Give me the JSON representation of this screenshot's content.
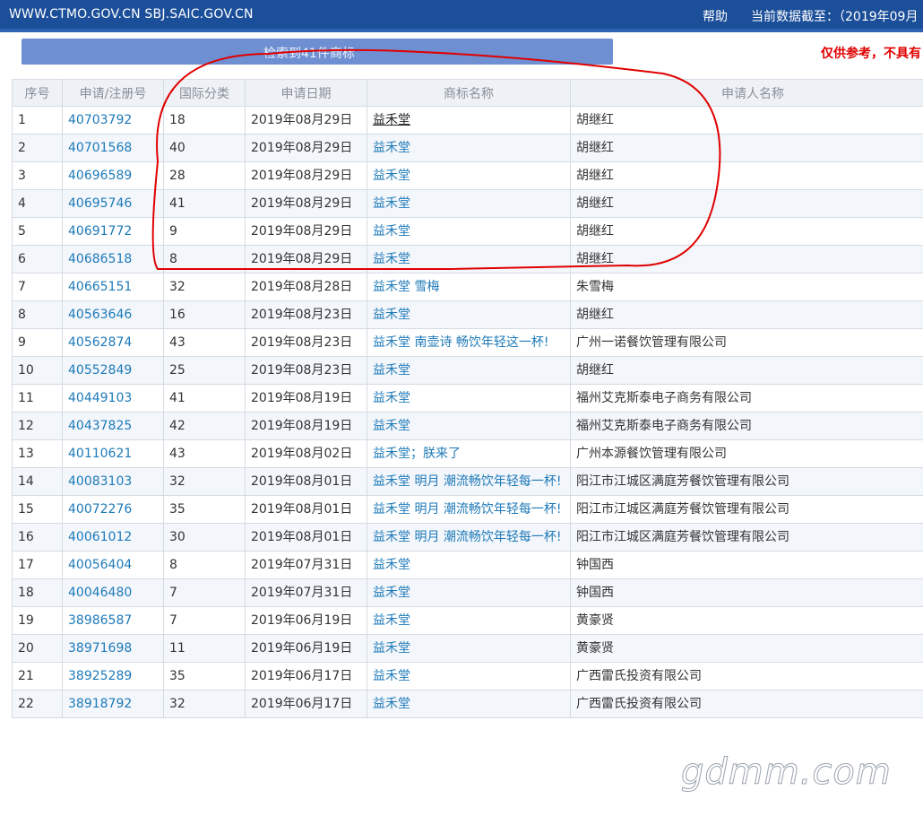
{
  "header": {
    "site": "WWW.CTMO.GOV.CN  SBJ.SAIC.GOV.CN",
    "help": "帮助",
    "as_of": "当前数据截至：（2019年09月"
  },
  "search": {
    "result_text": "检索到41件商标"
  },
  "notice": "仅供参考，不具有",
  "table": {
    "headers": [
      "序号",
      "申请/注册号",
      "国际分类",
      "申请日期",
      "商标名称",
      "申请人名称"
    ],
    "rows": [
      {
        "no": "1",
        "reg": "40703792",
        "cls": "18",
        "date": "2019年08月29日",
        "mark": "益禾堂",
        "applicant": "胡继红"
      },
      {
        "no": "2",
        "reg": "40701568",
        "cls": "40",
        "date": "2019年08月29日",
        "mark": "益禾堂",
        "applicant": "胡继红"
      },
      {
        "no": "3",
        "reg": "40696589",
        "cls": "28",
        "date": "2019年08月29日",
        "mark": "益禾堂",
        "applicant": "胡继红"
      },
      {
        "no": "4",
        "reg": "40695746",
        "cls": "41",
        "date": "2019年08月29日",
        "mark": "益禾堂",
        "applicant": "胡继红"
      },
      {
        "no": "5",
        "reg": "40691772",
        "cls": "9",
        "date": "2019年08月29日",
        "mark": "益禾堂",
        "applicant": "胡继红"
      },
      {
        "no": "6",
        "reg": "40686518",
        "cls": "8",
        "date": "2019年08月29日",
        "mark": "益禾堂",
        "applicant": "胡继红"
      },
      {
        "no": "7",
        "reg": "40665151",
        "cls": "32",
        "date": "2019年08月28日",
        "mark": "益禾堂 雪梅",
        "applicant": "朱雪梅"
      },
      {
        "no": "8",
        "reg": "40563646",
        "cls": "16",
        "date": "2019年08月23日",
        "mark": "益禾堂",
        "applicant": "胡继红"
      },
      {
        "no": "9",
        "reg": "40562874",
        "cls": "43",
        "date": "2019年08月23日",
        "mark": "益禾堂 南壶诗 畅饮年轻这一杯!",
        "applicant": "广州一诺餐饮管理有限公司"
      },
      {
        "no": "10",
        "reg": "40552849",
        "cls": "25",
        "date": "2019年08月23日",
        "mark": "益禾堂",
        "applicant": "胡继红"
      },
      {
        "no": "11",
        "reg": "40449103",
        "cls": "41",
        "date": "2019年08月19日",
        "mark": "益禾堂",
        "applicant": "福州艾克斯泰电子商务有限公司"
      },
      {
        "no": "12",
        "reg": "40437825",
        "cls": "42",
        "date": "2019年08月19日",
        "mark": "益禾堂",
        "applicant": "福州艾克斯泰电子商务有限公司"
      },
      {
        "no": "13",
        "reg": "40110621",
        "cls": "43",
        "date": "2019年08月02日",
        "mark": "益禾堂；朕来了",
        "applicant": "广州本源餐饮管理有限公司"
      },
      {
        "no": "14",
        "reg": "40083103",
        "cls": "32",
        "date": "2019年08月01日",
        "mark": "益禾堂 明月 潮流畅饮年轻每一杯!",
        "applicant": "阳江市江城区满庭芳餐饮管理有限公司"
      },
      {
        "no": "15",
        "reg": "40072276",
        "cls": "35",
        "date": "2019年08月01日",
        "mark": "益禾堂 明月 潮流畅饮年轻每一杯!",
        "applicant": "阳江市江城区满庭芳餐饮管理有限公司"
      },
      {
        "no": "16",
        "reg": "40061012",
        "cls": "30",
        "date": "2019年08月01日",
        "mark": "益禾堂 明月 潮流畅饮年轻每一杯!",
        "applicant": "阳江市江城区满庭芳餐饮管理有限公司"
      },
      {
        "no": "17",
        "reg": "40056404",
        "cls": "8",
        "date": "2019年07月31日",
        "mark": "益禾堂",
        "applicant": "钟国西"
      },
      {
        "no": "18",
        "reg": "40046480",
        "cls": "7",
        "date": "2019年07月31日",
        "mark": "益禾堂",
        "applicant": "钟国西"
      },
      {
        "no": "19",
        "reg": "38986587",
        "cls": "7",
        "date": "2019年06月19日",
        "mark": "益禾堂",
        "applicant": "黄豪贤"
      },
      {
        "no": "20",
        "reg": "38971698",
        "cls": "11",
        "date": "2019年06月19日",
        "mark": "益禾堂",
        "applicant": "黄豪贤"
      },
      {
        "no": "21",
        "reg": "38925289",
        "cls": "35",
        "date": "2019年06月17日",
        "mark": "益禾堂",
        "applicant": "广西雷氏投资有限公司"
      },
      {
        "no": "22",
        "reg": "38918792",
        "cls": "32",
        "date": "2019年06月17日",
        "mark": "益禾堂",
        "applicant": "广西雷氏投资有限公司"
      }
    ]
  },
  "watermark": "gdmm.com",
  "colors": {
    "header_bg": "#1c4f9a",
    "search_bar": "#6e8fd1",
    "link": "#1e7ab8",
    "notice": "#e00000",
    "annotation": "#e00000"
  }
}
